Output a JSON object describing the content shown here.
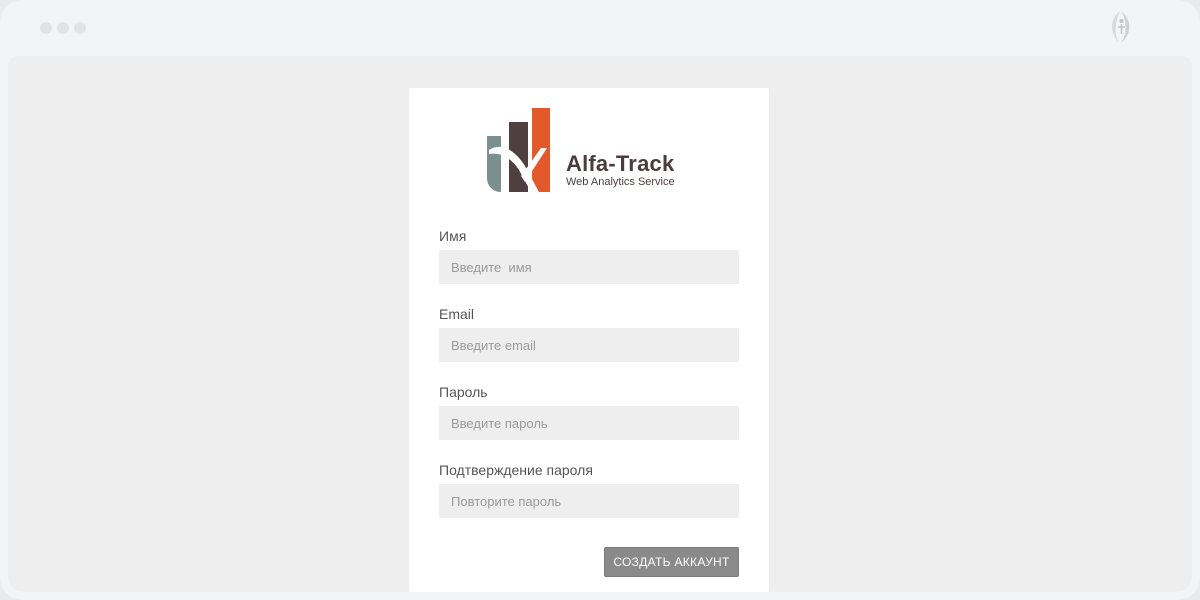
{
  "window": {
    "traffic_lights": [
      "dot",
      "dot",
      "dot"
    ],
    "corner_icon": "brand-leaf-icon"
  },
  "logo": {
    "name": "Alfa-Track",
    "tagline": "Web Analytics Service",
    "colors": {
      "teal": "#7a908e",
      "brown": "#4f3f3f",
      "orange": "#e2592b"
    }
  },
  "form": {
    "fields": [
      {
        "label": "Имя",
        "placeholder": "Введите  имя",
        "value": ""
      },
      {
        "label": "Email",
        "placeholder": "Введите email",
        "value": ""
      },
      {
        "label": "Пароль",
        "placeholder": "Введите пароль",
        "value": ""
      },
      {
        "label": "Подтверждение пароля",
        "placeholder": "Повторите пароль",
        "value": ""
      }
    ],
    "submit_label": "СОЗДАТЬ  АККАУНТ"
  },
  "colors": {
    "card_bg": "#ffffff",
    "page_bg": "#eeeeee",
    "input_bg": "#eeeeee",
    "button_bg": "#8a8a8a"
  }
}
